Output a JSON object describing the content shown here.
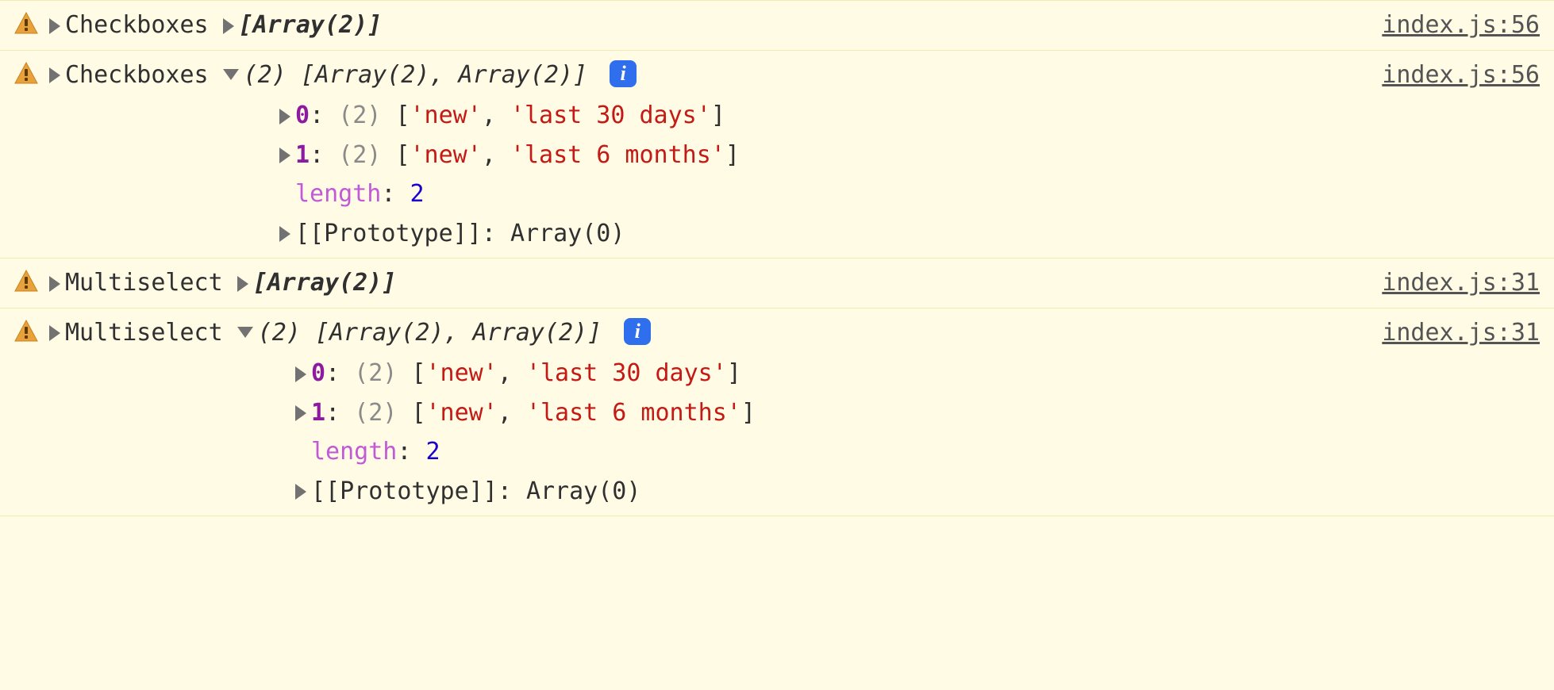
{
  "rows": [
    {
      "label": "Checkboxes",
      "expanded": false,
      "summary": "[Array(2)]",
      "source": "index.js:56"
    },
    {
      "label": "Checkboxes",
      "expanded": true,
      "count": "(2)",
      "summary": "[Array(2), Array(2)]",
      "info": "i",
      "source": "index.js:56",
      "children": [
        {
          "index": "0",
          "count": "(2)",
          "open_bracket": "[",
          "v0": "'new'",
          "comma": ", ",
          "v1": "'last 30 days'",
          "close_bracket": "]"
        },
        {
          "index": "1",
          "count": "(2)",
          "open_bracket": "[",
          "v0": "'new'",
          "comma": ", ",
          "v1": "'last 6 months'",
          "close_bracket": "]"
        }
      ],
      "length_label": "length",
      "length_value": "2",
      "proto_label": "[[Prototype]]",
      "proto_value": "Array(0)"
    },
    {
      "label": "Multiselect",
      "expanded": false,
      "summary": "[Array(2)]",
      "source": "index.js:31"
    },
    {
      "label": "Multiselect",
      "expanded": true,
      "count": "(2)",
      "summary": "[Array(2), Array(2)]",
      "info": "i",
      "source": "index.js:31",
      "children": [
        {
          "index": "0",
          "count": "(2)",
          "open_bracket": "[",
          "v0": "'new'",
          "comma": ", ",
          "v1": "'last 30 days'",
          "close_bracket": "]"
        },
        {
          "index": "1",
          "count": "(2)",
          "open_bracket": "[",
          "v0": "'new'",
          "comma": ", ",
          "v1": "'last 6 months'",
          "close_bracket": "]"
        }
      ],
      "length_label": "length",
      "length_value": "2",
      "proto_label": "[[Prototype]]",
      "proto_value": "Array(0)"
    }
  ]
}
